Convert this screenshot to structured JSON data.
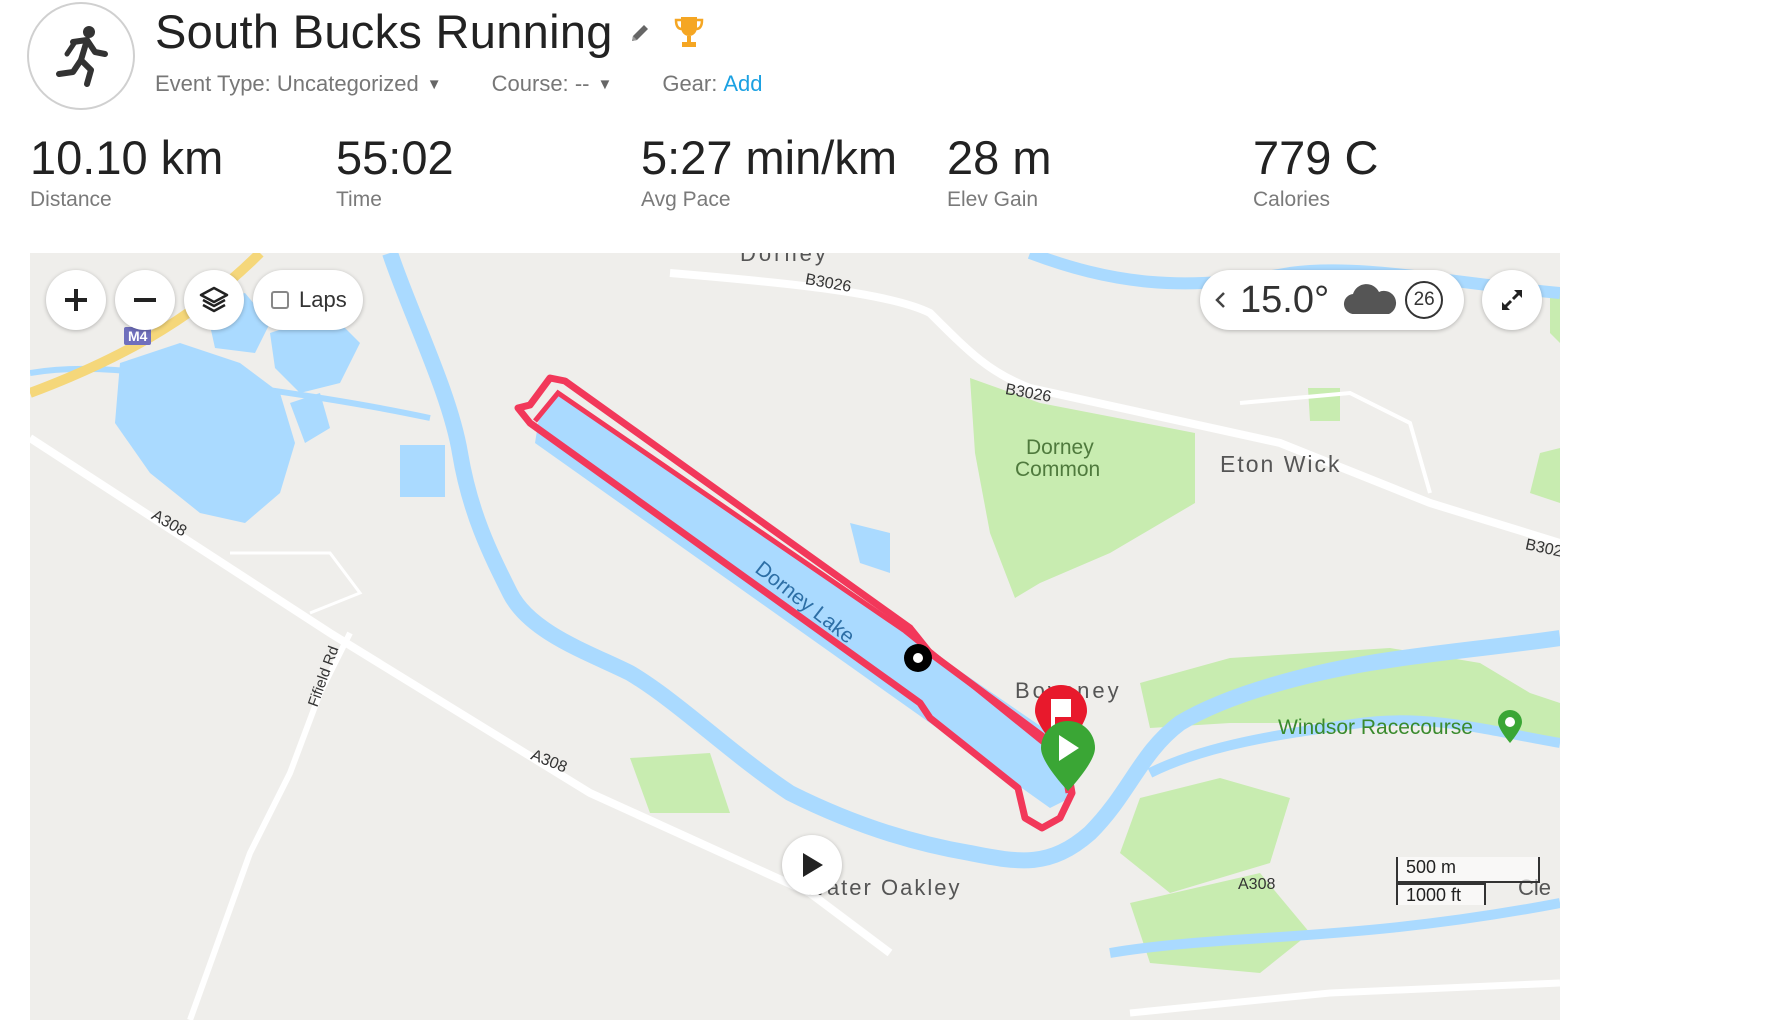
{
  "activity": {
    "title": "South Bucks Running",
    "icon": "running-person-icon",
    "event_type_label": "Event Type:",
    "event_type_value": "Uncategorized",
    "course_label": "Course:",
    "course_value": "--",
    "gear_label": "Gear:",
    "gear_action": "Add"
  },
  "stats": [
    {
      "value": "10.10 km",
      "label": "Distance"
    },
    {
      "value": "55:02",
      "label": "Time"
    },
    {
      "value": "5:27 min/km",
      "label": "Avg Pace"
    },
    {
      "value": "28 m",
      "label": "Elev Gain"
    },
    {
      "value": "779 C",
      "label": "Calories"
    }
  ],
  "map_controls": {
    "laps_label": "Laps",
    "laps_checked": false,
    "temperature": "15.0°",
    "weather_icon": "cloud-icon",
    "wind_speed": "26"
  },
  "map_labels": {
    "dorney_top": "Dorney",
    "b3026_a": "B3026",
    "b3026_b": "B3026",
    "b3026_c": "B302",
    "m4": "M4",
    "dorney_common_1": "Dorney",
    "dorney_common_2": "Common",
    "eton_wick": "Eton Wick",
    "a308_a": "A308",
    "a308_b": "A308",
    "a308_c": "A308",
    "dorney_lake": "Dorney Lake",
    "fifield_rd": "Fifield Rd",
    "boveney": "Boveney",
    "windsor_racecourse": "Windsor Racecourse",
    "water_oakley": "Water Oakley",
    "scale_m": "500 m",
    "scale_ft": "1000 ft",
    "clewer": "Cle"
  },
  "colors": {
    "accent_link": "#1ba1e2",
    "route": "#f2385a",
    "water": "#aadaff",
    "park": "#c8ecb0",
    "start_marker": "#3aa635",
    "end_marker": "#e8192c"
  }
}
